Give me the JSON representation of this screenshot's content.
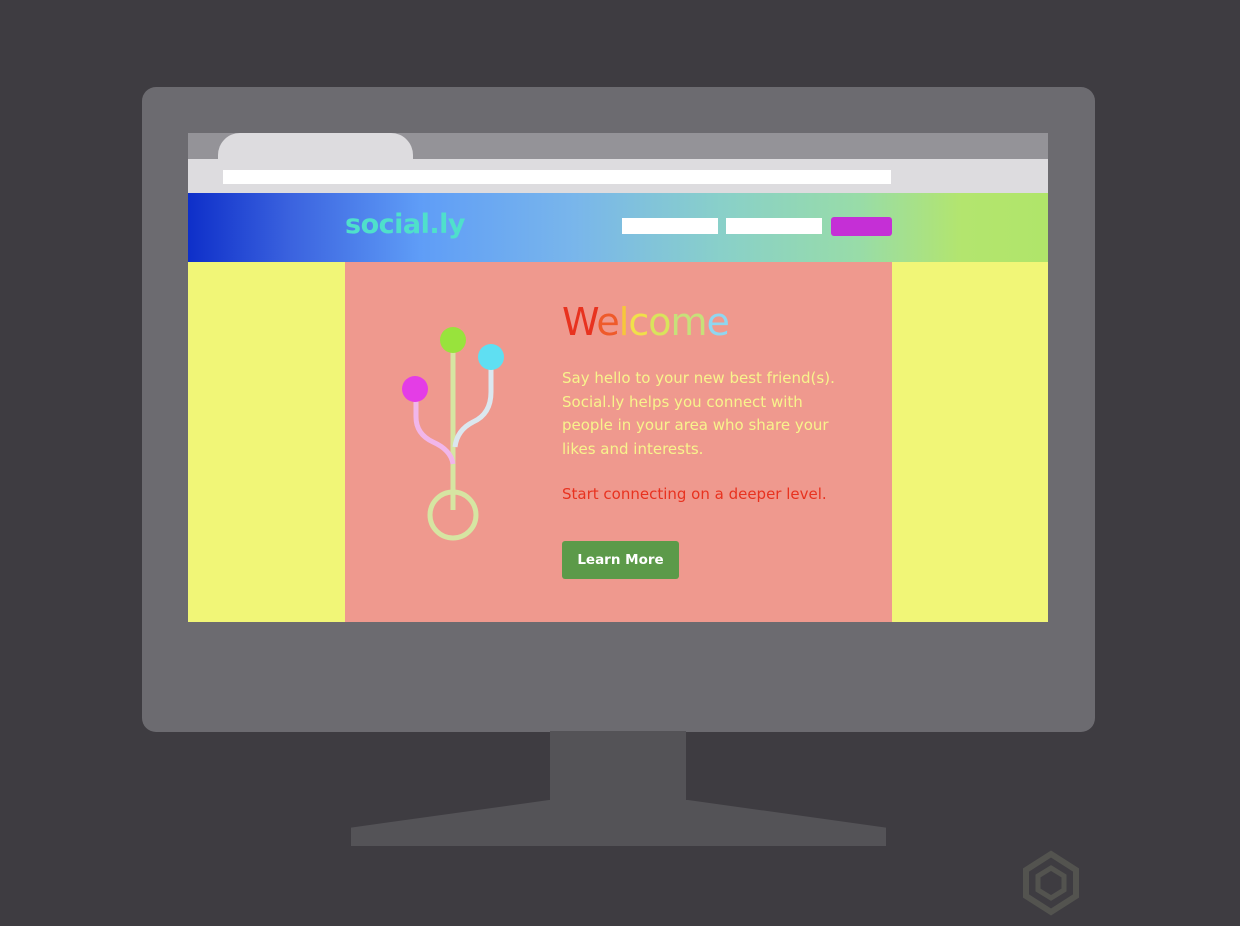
{
  "site": {
    "logo": "social.ly",
    "welcome_letters": [
      {
        "ch": "W",
        "color": "#e8321f"
      },
      {
        "ch": "e",
        "color": "#ef5a2a"
      },
      {
        "ch": "l",
        "color": "#f6c73a"
      },
      {
        "ch": "c",
        "color": "#f0e04a"
      },
      {
        "ch": "o",
        "color": "#d9e35c"
      },
      {
        "ch": "m",
        "color": "#c7e07a"
      },
      {
        "ch": "e",
        "color": "#8fd6f0"
      }
    ],
    "intro": "Say hello to your new best friend(s). Social.ly helps you connect with people in your area who share your likes and interests.",
    "tagline": "Start connecting on a deeper level.",
    "cta_label": "Learn More"
  },
  "colors": {
    "background": "#3e3c41",
    "monitor": "#6c6b70",
    "page_side": "#f1f677",
    "hero_panel": "#ef998e",
    "nav_cta": "#c52fd6",
    "button": "#5c9a49",
    "logo": "#4fe0cb",
    "intro_text": "#f8f48c",
    "tagline_text": "#e8321f"
  },
  "icons": {
    "hero_illustration": "usb-branch-icon",
    "watermark": "watermark-logo-icon"
  }
}
